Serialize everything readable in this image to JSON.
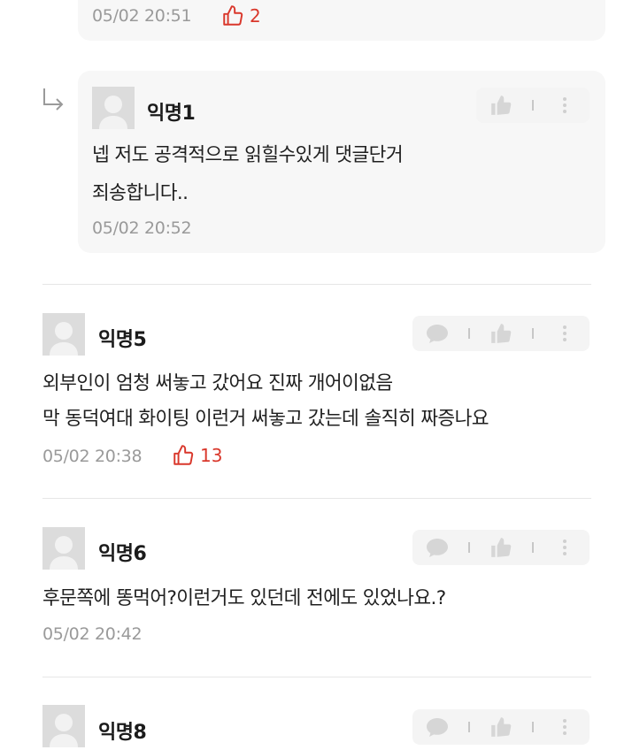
{
  "comments": {
    "top_reply": {
      "time": "05/02 20:51",
      "likes": "2"
    },
    "reply": {
      "author": "익명1",
      "lines": [
        "넵 저도 공격적으로 읽힐수있게 댓글단거",
        "죄송합니다.."
      ],
      "time": "05/02 20:52"
    },
    "c5": {
      "author": "익명5",
      "lines": [
        "외부인이 엄청 써놓고 갔어요 진짜 개어이없음",
        "막 동덕여대 화이팅 이런거 써놓고 갔는데 솔직히 짜증나요"
      ],
      "time": "05/02 20:38",
      "likes": "13"
    },
    "c6": {
      "author": "익명6",
      "lines": [
        "후문쪽에 똥먹어?이런거도 있던데 전에도 있었나요.?"
      ],
      "time": "05/02 20:42"
    },
    "c8": {
      "author": "익명8"
    }
  },
  "colors": {
    "like": "#d9372b",
    "meta": "#9a9a9a",
    "reply_bg": "#f7f7f7"
  },
  "icons": [
    "reply-arrow-icon",
    "thumbs-up-icon",
    "comment-bubble-icon",
    "more-vertical-icon",
    "avatar-placeholder-icon"
  ]
}
